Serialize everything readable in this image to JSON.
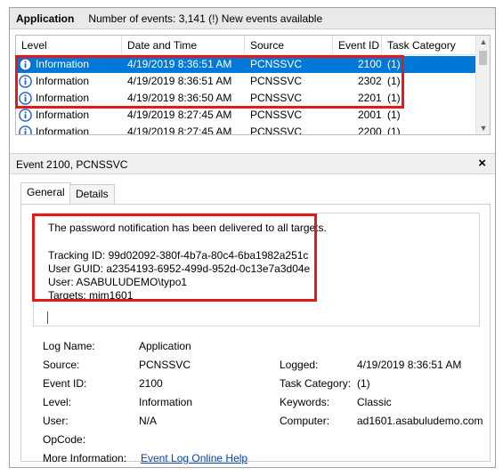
{
  "titlebar": {
    "app_name": "Application",
    "info": "Number of events: 3,141 (!) New events available"
  },
  "events": {
    "columns": [
      "Level",
      "Date and Time",
      "Source",
      "Event ID",
      "Task Category"
    ],
    "rows": [
      {
        "level": "Information",
        "datetime": "4/19/2019 8:36:51 AM",
        "source": "PCNSSVC",
        "event_id": "2100",
        "task": "(1)",
        "selected": true
      },
      {
        "level": "Information",
        "datetime": "4/19/2019 8:36:51 AM",
        "source": "PCNSSVC",
        "event_id": "2302",
        "task": "(1)",
        "selected": false
      },
      {
        "level": "Information",
        "datetime": "4/19/2019 8:36:50 AM",
        "source": "PCNSSVC",
        "event_id": "2201",
        "task": "(1)",
        "selected": false
      },
      {
        "level": "Information",
        "datetime": "4/19/2019 8:27:45 AM",
        "source": "PCNSSVC",
        "event_id": "2001",
        "task": "(1)",
        "selected": false
      },
      {
        "level": "Information",
        "datetime": "4/19/2019 8:27:45 AM",
        "source": "PCNSSVC",
        "event_id": "2200",
        "task": "(1)",
        "selected": false
      }
    ]
  },
  "detail": {
    "header_title": "Event 2100, PCNSSVC",
    "close_glyph": "×",
    "tabs": [
      "General",
      "Details"
    ],
    "message": {
      "line1": "The password notification has been delivered to all targets.",
      "tracking_id": "Tracking ID: 99d02092-380f-4b7a-80c4-6ba1982a251c",
      "user_guid": "User GUID: a2354193-6952-499d-952d-0c13e7a3d04e",
      "user": "User: ASABULUDEMO\\typo1",
      "targets": "Targets: mim1601"
    },
    "fields": {
      "log_name_label": "Log Name:",
      "log_name": "Application",
      "source_label": "Source:",
      "source": "PCNSSVC",
      "event_id_label": "Event ID:",
      "event_id": "2100",
      "level_label": "Level:",
      "level": "Information",
      "user_label": "User:",
      "user": "N/A",
      "opcode_label": "OpCode:",
      "more_info_label": "More Information:",
      "more_info_link": "Event Log Online Help",
      "logged_label": "Logged:",
      "logged": "4/19/2019 8:36:51 AM",
      "task_category_label": "Task Category:",
      "task_category": "(1)",
      "keywords_label": "Keywords:",
      "keywords": "Classic",
      "computer_label": "Computer:",
      "computer": "ad1601.asabuludemo.com"
    }
  },
  "colors": {
    "selection": "#0078d7",
    "highlight_box": "#e01b1b",
    "link": "#0645ad",
    "info_icon": "#1f5fbf"
  },
  "icons": {
    "level_icon": "info-icon",
    "scroll_up": "chevron-up-icon",
    "scroll_down": "chevron-down-icon",
    "close": "close-icon"
  }
}
